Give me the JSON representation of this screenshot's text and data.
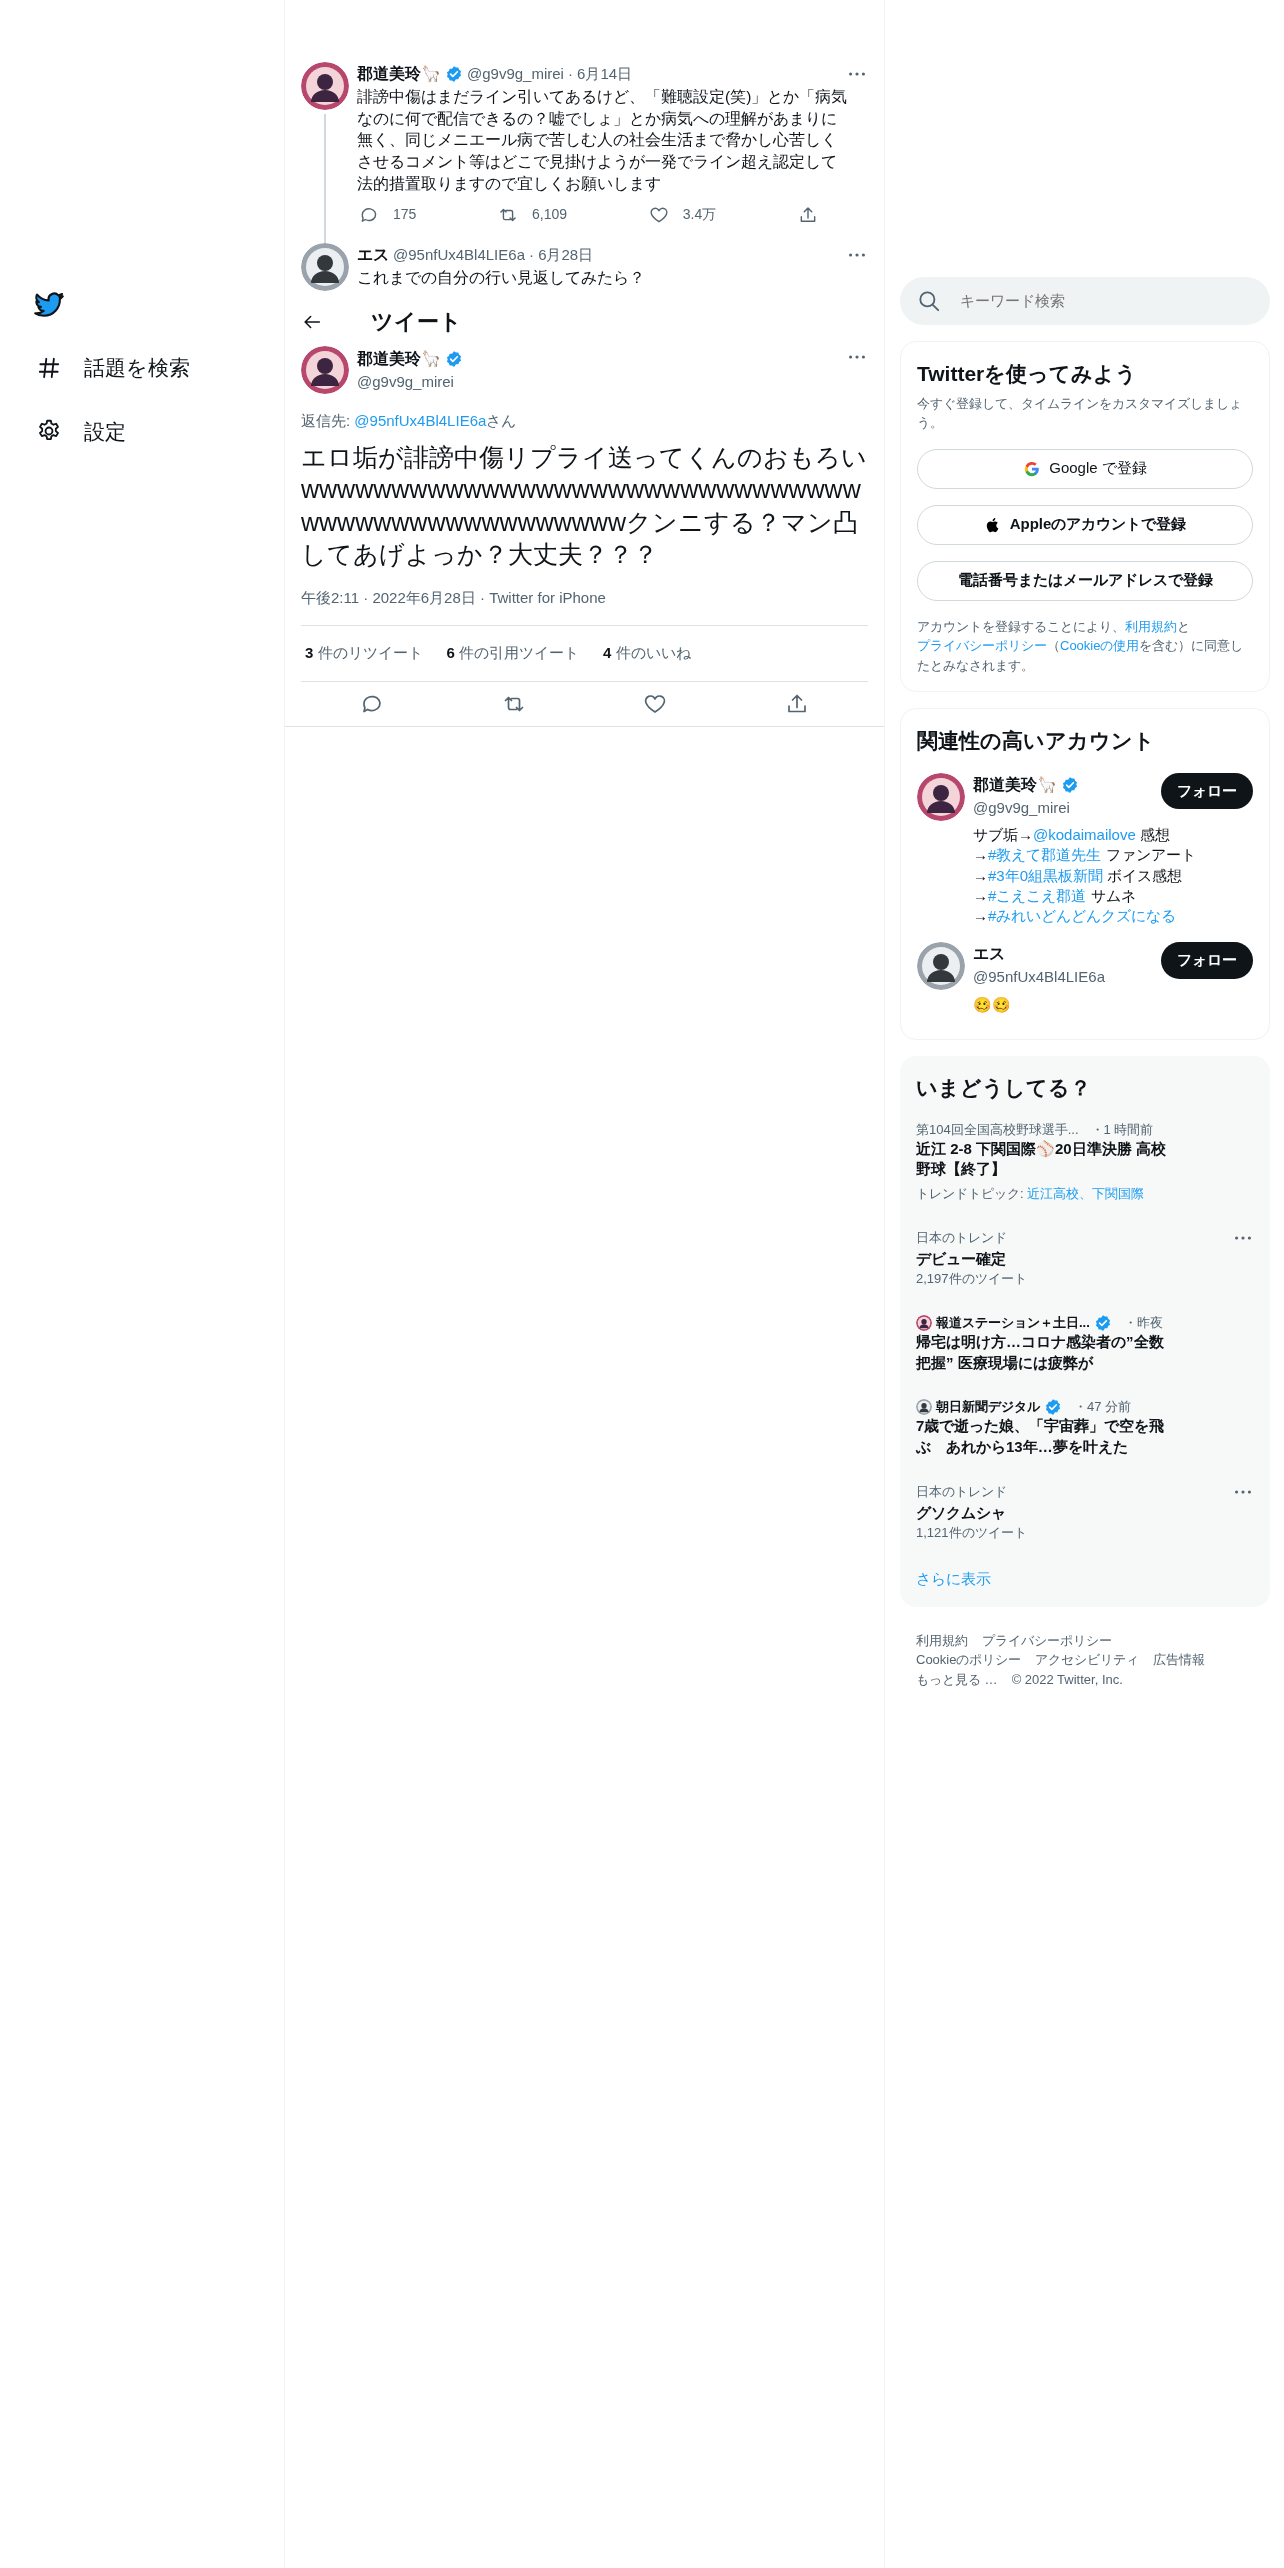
{
  "sidebar": {
    "items": [
      {
        "kind": "explore",
        "label": "話題を検索"
      },
      {
        "kind": "settings",
        "label": "設定"
      }
    ]
  },
  "thread": [
    {
      "name": "郡道美玲🦙",
      "verified": true,
      "handle": "@g9v9g_mirei",
      "date": "· 6月14日",
      "text": "誹謗中傷はまだライン引いてあるけど、「難聴設定(笑)」とか「病気なのに何で配信できるの？嘘でしょ」とか病気への理解があまりに無く、同じメニエール病で苦しむ人の社会生活まで脅かし心苦しくさせるコメント等はどこで見掛けようが一発でライン超え認定して法的措置取りますので宜しくお願いします",
      "actions": [
        {
          "kind": "reply",
          "count": "175"
        },
        {
          "kind": "retweet",
          "count": "6,109"
        },
        {
          "kind": "like",
          "count": "3.4万"
        },
        {
          "kind": "share"
        }
      ]
    },
    {
      "name": "エス",
      "verified": false,
      "handle": "@95nfUx4Bl4LIE6a",
      "date": "· 6月28日",
      "text": "これまでの自分の行い見返してみたら？"
    }
  ],
  "header": {
    "title": "ツイート"
  },
  "tweet": {
    "name": "郡道美玲🦙",
    "verified": true,
    "handle": "@g9v9g_mirei",
    "reply_to": {
      "prefix": "返信先: ",
      "handle": "@95nfUx4Bl4LIE6a",
      "suffix": "さん"
    },
    "text": "エロ垢が誹謗中傷リプライ送ってくんのおもろいwwwwwwwwwwwwwwwwwwwwwwwwwwwwwwwwwwwwwwwwwwwwwwwwwクンニする？マン凸してあげよっか？大丈夫？？？",
    "meta": "午後2:11 · 2022年6月28日 · Twitter for iPhone",
    "stats": [
      {
        "count": "3",
        "label": "件のリツイート"
      },
      {
        "count": "6",
        "label": "件の引用ツイート"
      },
      {
        "count": "4",
        "label": "件のいいね"
      }
    ],
    "actions": [
      {
        "kind": "reply"
      },
      {
        "kind": "retweet"
      },
      {
        "kind": "like"
      },
      {
        "kind": "share"
      }
    ]
  },
  "search": {
    "placeholder": "キーワード検索"
  },
  "signup": {
    "title": "Twitterを使ってみよう",
    "description": "今すぐ登録して、タイムラインをカスタマイズしましょう。",
    "buttons": [
      {
        "kind": "google",
        "label": "Google で登録"
      },
      {
        "kind": "apple",
        "label": "Appleのアカウントで登録"
      },
      {
        "kind": "plain",
        "label": "電話番号またはメールアドレスで登録"
      }
    ],
    "legal": [
      {
        "text": "アカウントを登録することにより、",
        "link": false
      },
      {
        "text": "利用規約",
        "link": true
      },
      {
        "text": "と",
        "link": false
      },
      {
        "text": "プライバシーポリシー",
        "link": true
      },
      {
        "text": "（",
        "link": false
      },
      {
        "text": "Cookieの使用",
        "link": true
      },
      {
        "text": "を含む）に同意したとみなされます。",
        "link": false
      }
    ]
  },
  "related": {
    "title": "関連性の高いアカウント",
    "accounts": [
      {
        "name": "郡道美玲🦙",
        "verified": true,
        "handle": "@g9v9g_mirei",
        "button": "フォロー",
        "bio": [
          {
            "text": "サブ垢→",
            "link": false
          },
          {
            "text": "@kodaimailove",
            "link": true
          },
          {
            "text": " 感想→",
            "link": false
          },
          {
            "text": "#教えて郡道先生",
            "link": true
          },
          {
            "text": " ファンアート→",
            "link": false
          },
          {
            "text": "#3年0組黒板新聞",
            "link": true
          },
          {
            "text": " ボイス感想→",
            "link": false
          },
          {
            "text": "#こえこえ郡道",
            "link": true
          },
          {
            "text": " サムネ→",
            "link": false
          },
          {
            "text": "#みれいどんどんクズになる",
            "link": true
          }
        ]
      },
      {
        "name": "エス",
        "verified": false,
        "handle": "@95nfUx4Bl4LIE6a",
        "button": "フォロー",
        "bio": "🥴🥴"
      }
    ]
  },
  "trends": {
    "title": "いまどうしてる？",
    "items": [
      {
        "kind": "event",
        "context": "第104回全国高校野球選手...",
        "time": "・1 時間前",
        "title": "近江 2-8 下関国際⚾20日準決勝 高校野球【終了】",
        "topic_label": "トレンドトピック: ",
        "topic_link": "近江高校、下関国際"
      },
      {
        "kind": "trend",
        "context": "日本のトレンド",
        "title": "デビュー確定",
        "count": "2,197件のツイート"
      },
      {
        "kind": "news",
        "context": "報道ステーション＋土日...",
        "verified": true,
        "time": "・昨夜",
        "title": "帰宅は明け方…コロナ感染者の”全数把握” 医療現場には疲弊が"
      },
      {
        "kind": "news",
        "context": "朝日新聞デジタル",
        "verified": true,
        "time": "・47 分前",
        "title": "7歳で逝った娘、「宇宙葬」で空を飛ぶ　あれから13年…夢を叶えた"
      },
      {
        "kind": "trend",
        "context": "日本のトレンド",
        "title": "グソクムシャ",
        "count": "1,121件のツイート"
      }
    ],
    "more": "さらに表示"
  },
  "footer": {
    "links": [
      "利用規約",
      "プライバシーポリシー",
      "Cookieのポリシー",
      "アクセシビリティ",
      "広告情報",
      "もっと見る …",
      "© 2022 Twitter, Inc."
    ]
  }
}
